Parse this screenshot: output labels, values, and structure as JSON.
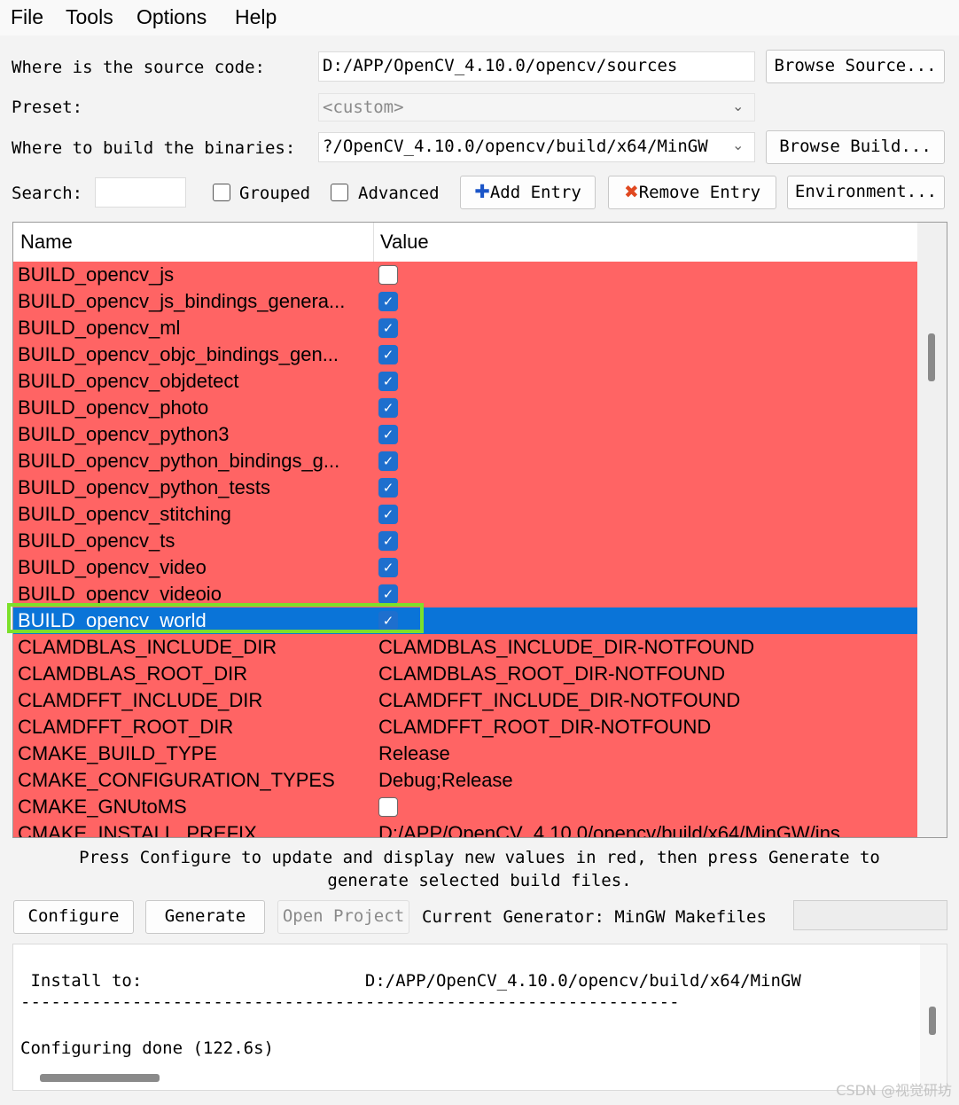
{
  "menu": [
    "File",
    "Tools",
    "Options",
    "Help"
  ],
  "source": {
    "label": "Where is the source code:",
    "value": "D:/APP/OpenCV_4.10.0/opencv/sources",
    "browse_label": "Browse Source..."
  },
  "preset": {
    "label": "Preset:",
    "value": "<custom>"
  },
  "build": {
    "label": "Where to build the binaries:",
    "value": "?/OpenCV_4.10.0/opencv/build/x64/MinGW",
    "browse_label": "Browse Build..."
  },
  "toolbar": {
    "search_label": "Search:",
    "search_value": "",
    "grouped_label": "Grouped",
    "advanced_label": "Advanced",
    "add_entry_label": "Add Entry",
    "remove_entry_label": "Remove Entry",
    "environment_label": "Environment..."
  },
  "table": {
    "headers": {
      "name": "Name",
      "value": "Value"
    },
    "rows": [
      {
        "name": "BUILD_opencv_js",
        "type": "bool",
        "checked": false
      },
      {
        "name": "BUILD_opencv_js_bindings_genera...",
        "type": "bool",
        "checked": true
      },
      {
        "name": "BUILD_opencv_ml",
        "type": "bool",
        "checked": true
      },
      {
        "name": "BUILD_opencv_objc_bindings_gen...",
        "type": "bool",
        "checked": true
      },
      {
        "name": "BUILD_opencv_objdetect",
        "type": "bool",
        "checked": true
      },
      {
        "name": "BUILD_opencv_photo",
        "type": "bool",
        "checked": true
      },
      {
        "name": "BUILD_opencv_python3",
        "type": "bool",
        "checked": true
      },
      {
        "name": "BUILD_opencv_python_bindings_g...",
        "type": "bool",
        "checked": true
      },
      {
        "name": "BUILD_opencv_python_tests",
        "type": "bool",
        "checked": true
      },
      {
        "name": "BUILD_opencv_stitching",
        "type": "bool",
        "checked": true
      },
      {
        "name": "BUILD_opencv_ts",
        "type": "bool",
        "checked": true
      },
      {
        "name": "BUILD_opencv_video",
        "type": "bool",
        "checked": true
      },
      {
        "name": "BUILD_opencv_videoio",
        "type": "bool",
        "checked": true
      },
      {
        "name": "BUILD_opencv_world",
        "type": "bool",
        "checked": true,
        "selected": true
      },
      {
        "name": "CLAMDBLAS_INCLUDE_DIR",
        "type": "text",
        "value": "CLAMDBLAS_INCLUDE_DIR-NOTFOUND"
      },
      {
        "name": "CLAMDBLAS_ROOT_DIR",
        "type": "text",
        "value": "CLAMDBLAS_ROOT_DIR-NOTFOUND"
      },
      {
        "name": "CLAMDFFT_INCLUDE_DIR",
        "type": "text",
        "value": "CLAMDFFT_INCLUDE_DIR-NOTFOUND"
      },
      {
        "name": "CLAMDFFT_ROOT_DIR",
        "type": "text",
        "value": "CLAMDFFT_ROOT_DIR-NOTFOUND"
      },
      {
        "name": "CMAKE_BUILD_TYPE",
        "type": "text",
        "value": "Release"
      },
      {
        "name": "CMAKE_CONFIGURATION_TYPES",
        "type": "text",
        "value": "Debug;Release"
      },
      {
        "name": "CMAKE_GNUtoMS",
        "type": "bool",
        "checked": false
      },
      {
        "name": "CMAKE_INSTALL_PREFIX",
        "type": "text",
        "value": "D:/APP/OpenCV_4.10.0/opencv/build/x64/MinGW/ins"
      }
    ]
  },
  "hint": {
    "line1": "Press Configure to update and display new values in red, then press Generate to",
    "line2": "generate selected build files."
  },
  "actions": {
    "configure_label": "Configure",
    "generate_label": "Generate",
    "open_project_label": "Open Project",
    "current_generator_label": "Current Generator: MinGW Makefiles"
  },
  "output": {
    "install_line": " Install to:                      D:/APP/OpenCV_4.10.0/opencv/build/x64/MinGW",
    "divider_line": "-----------------------------------------------------------------",
    "done_line": "Configuring done (122.6s)"
  },
  "watermark": "CSDN @视觉研坊",
  "colors": {
    "changed_row": "#ff6464",
    "selected_row": "#0a74d8",
    "highlight_box": "#7ce02a",
    "checkbox_on": "#1e6fce"
  }
}
